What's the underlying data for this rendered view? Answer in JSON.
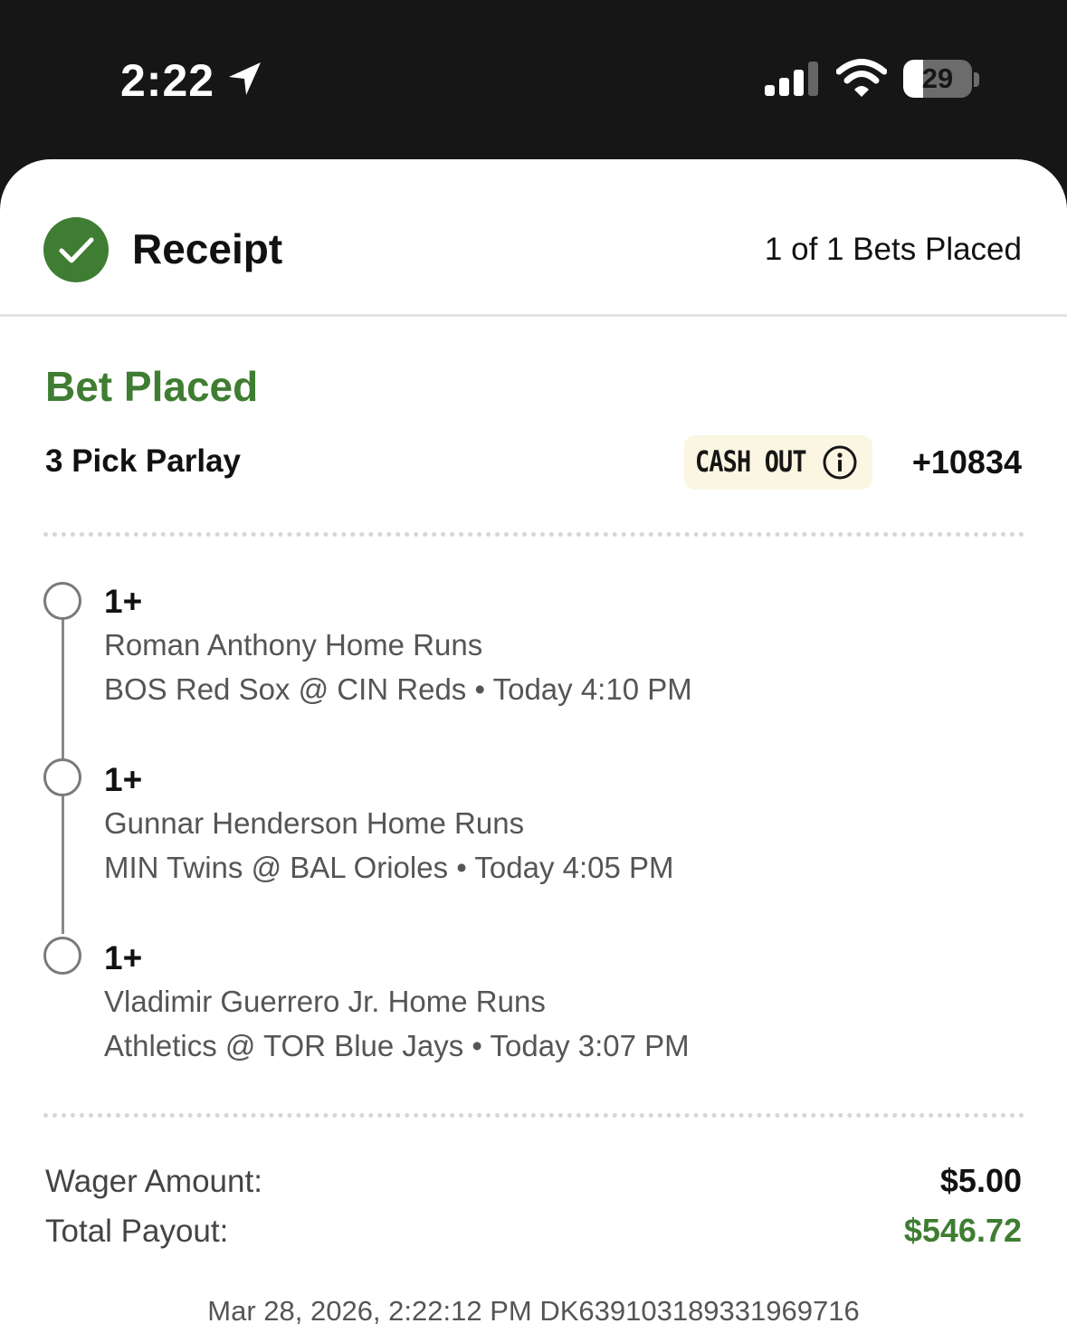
{
  "status_bar": {
    "time": "2:22",
    "battery_level": "29",
    "icons": [
      "location-arrow-icon",
      "cellular-signal-icon",
      "wifi-icon",
      "battery-icon"
    ]
  },
  "header": {
    "title": "Receipt",
    "bets_placed": "1 of 1 Bets Placed"
  },
  "bet": {
    "status": "Bet Placed",
    "type": "3 Pick Parlay",
    "cashout_label": "CASH OUT",
    "odds": "+10834",
    "legs": [
      {
        "value": "1+",
        "market": "Roman Anthony Home Runs",
        "game": "BOS Red Sox @ CIN Reds • Today 4:10 PM"
      },
      {
        "value": "1+",
        "market": "Gunnar Henderson Home Runs",
        "game": "MIN Twins @ BAL Orioles • Today 4:05 PM"
      },
      {
        "value": "1+",
        "market": "Vladimir Guerrero Jr. Home Runs",
        "game": "Athletics @ TOR Blue Jays • Today 3:07 PM"
      }
    ]
  },
  "summary": {
    "wager_label": "Wager Amount:",
    "wager_value": "$5.00",
    "payout_label": "Total Payout:",
    "payout_value": "$546.72"
  },
  "footer": {
    "timestamp_id": "Mar 28, 2026, 2:22:12 PM DK639103189331969716"
  },
  "colors": {
    "accent_green": "#3f7d32",
    "cashout_bg": "#fbf6e2",
    "status_bar_bg": "#161616"
  }
}
